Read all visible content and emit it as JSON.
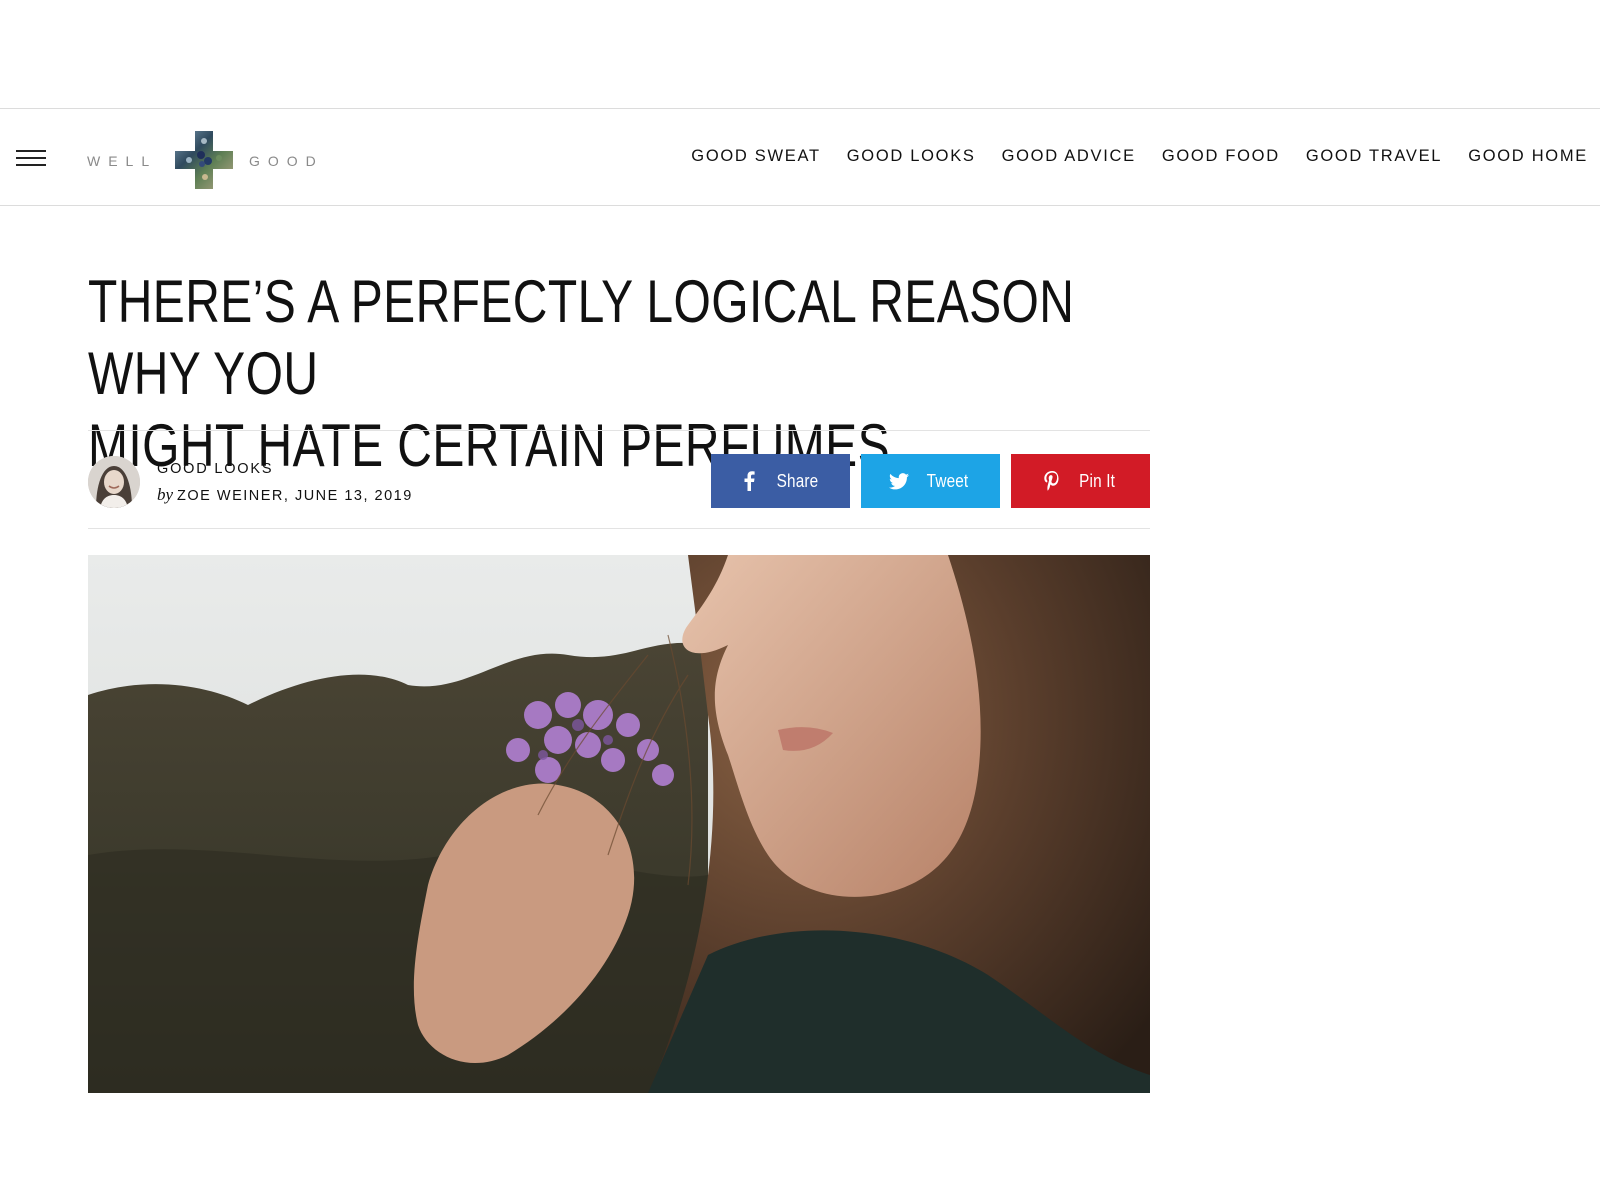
{
  "brand": {
    "word_left": "WELL",
    "word_right": "GOOD"
  },
  "nav": {
    "items": [
      {
        "label": "GOOD SWEAT"
      },
      {
        "label": "GOOD LOOKS"
      },
      {
        "label": "GOOD ADVICE"
      },
      {
        "label": "GOOD FOOD"
      },
      {
        "label": "GOOD TRAVEL"
      },
      {
        "label": "GOOD HOME"
      }
    ]
  },
  "article": {
    "headline_line1": "THERE’S A PERFECTLY LOGICAL REASON WHY YOU",
    "headline_line2": "MIGHT HATE CERTAIN PERFUMES",
    "category": "GOOD LOOKS",
    "by": "by",
    "author_date": "ZOE WEINER, JUNE 13, 2019"
  },
  "share": {
    "facebook_label": "Share",
    "twitter_label": "Tweet",
    "pinterest_label": "Pin It"
  },
  "colors": {
    "facebook": "#3b5da4",
    "twitter": "#1da4e6",
    "pinterest": "#d21b26"
  },
  "icons": {
    "menu": "hamburger-icon",
    "facebook": "facebook-icon",
    "twitter": "twitter-icon",
    "pinterest": "pinterest-icon"
  }
}
